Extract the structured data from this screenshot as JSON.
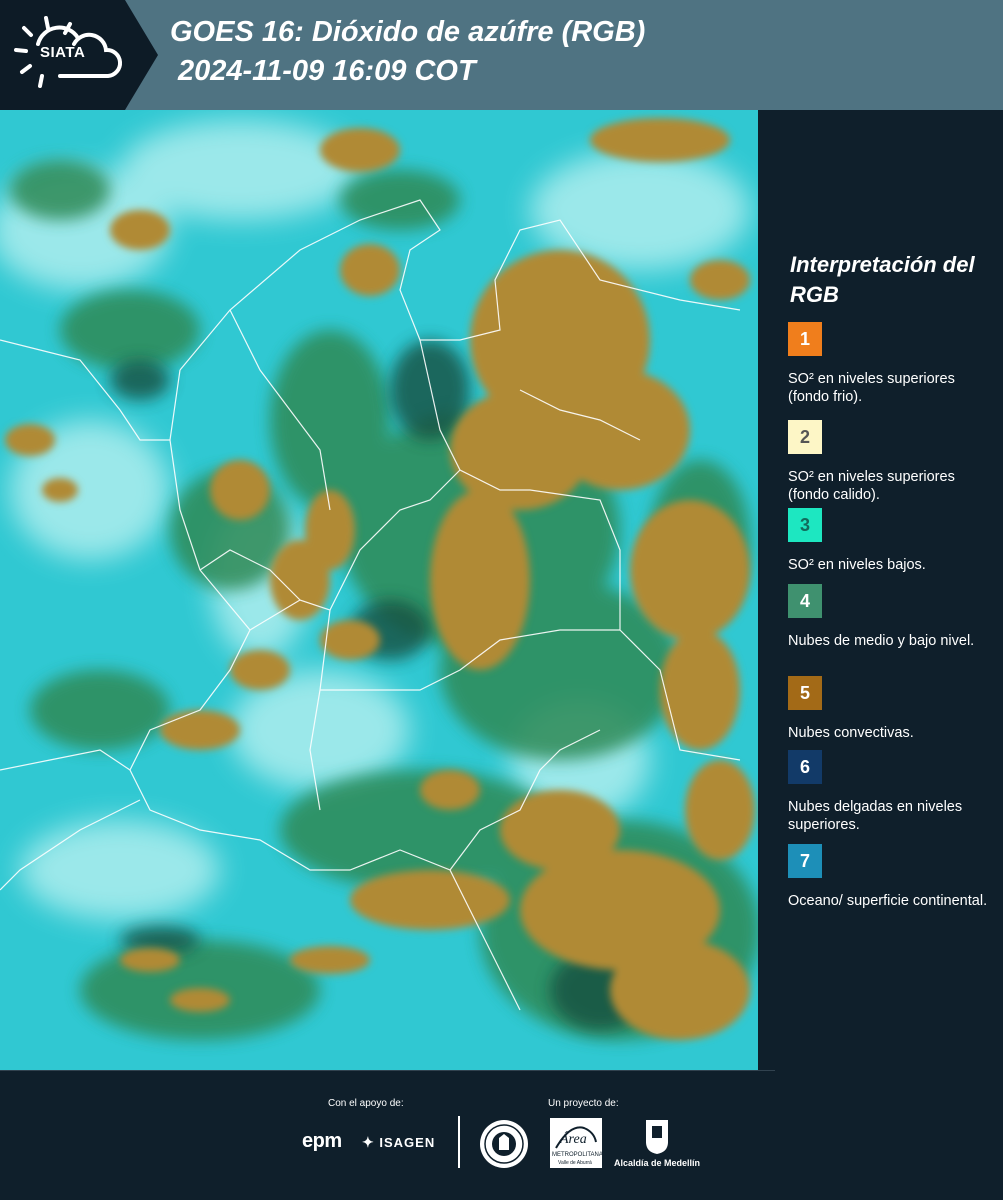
{
  "header": {
    "logo_text": "SIATA",
    "title_line1": "GOES 16: Dióxido de azúfre (RGB)",
    "title_line2": "2024-11-09 16:09 COT"
  },
  "legend": {
    "title": "Interpretación del RGB",
    "items": [
      {
        "number": "1",
        "color": "#f07e1c",
        "label": "SO² en niveles superiores (fondo frio)."
      },
      {
        "number": "2",
        "color": "#fdf6c6",
        "label": "SO² en niveles superiores (fondo calido)."
      },
      {
        "number": "3",
        "color": "#1de7c1",
        "label": "SO² en niveles bajos."
      },
      {
        "number": "4",
        "color": "#3f916f",
        "label": "Nubes de medio y bajo nivel."
      },
      {
        "number": "5",
        "color": "#a36a17",
        "label": "Nubes convectivas."
      },
      {
        "number": "6",
        "color": "#123a68",
        "label": "Nubes delgadas en niveles superiores."
      },
      {
        "number": "7",
        "color": "#1d8fb8",
        "label": "Oceano/ superficie continental."
      }
    ]
  },
  "footer": {
    "support_label": "Con el apoyo de:",
    "project_label": "Un proyecto de:",
    "sponsors": [
      "epm",
      "ISAGEN"
    ],
    "area_logo_text": "Área",
    "area_sub1": "METROPOLITANA",
    "area_sub2": "Valle de Aburrá",
    "alcaldia_label": "Alcaldía de Medellín"
  },
  "map": {
    "colors": {
      "ocean": "#30c8d2",
      "haze": "#bff3f2",
      "green": "#2f8a57",
      "dark": "#13503f",
      "convective": "#b08a35",
      "border": "#ffffff"
    }
  }
}
